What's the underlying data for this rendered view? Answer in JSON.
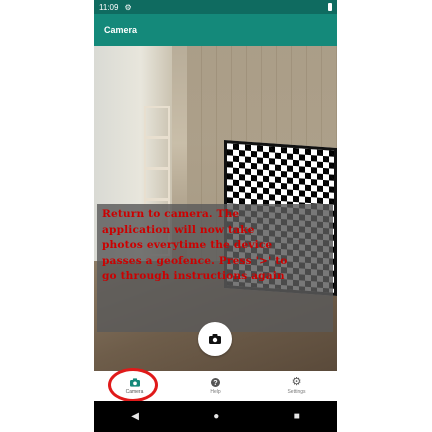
{
  "status_bar": {
    "time": "11:09"
  },
  "app_bar": {
    "title": "Camera"
  },
  "overlay": {
    "lines": [
      "Return to camera. The",
      "application will now take",
      "photos everytime the device",
      "passes a geofence. Press '>' to",
      "go through instructions again"
    ],
    "text_color": "#cc0000"
  },
  "bottom_nav": {
    "items": [
      {
        "label": "Camera",
        "icon": "camera-icon"
      },
      {
        "label": "Help",
        "icon": "help-icon"
      },
      {
        "label": "Settings",
        "icon": "gear-icon"
      }
    ],
    "active": "Camera"
  },
  "colors": {
    "primary": "#14897a",
    "primary_dark": "#0f6b60",
    "highlight": "#e01a1a"
  }
}
